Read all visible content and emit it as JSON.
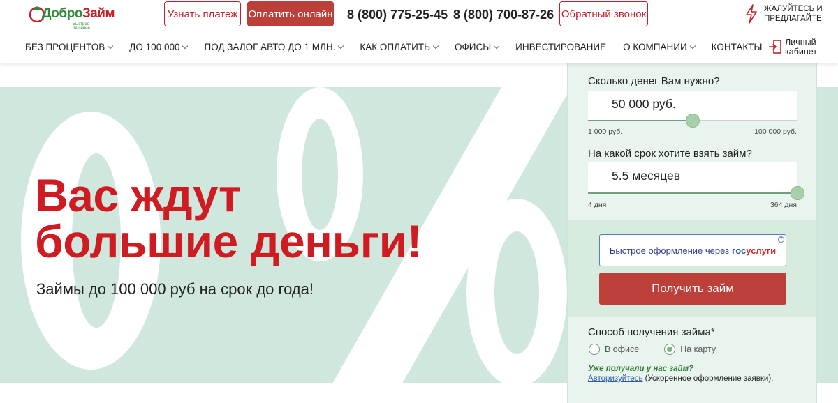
{
  "header": {
    "logo_text_1": "Добро",
    "logo_text_2": "Займ",
    "logo_sub": "Быстрое решение",
    "check_payment": "Узнать платеж",
    "pay_online": "Оплатить онлайн",
    "phone_1": "8 (800) 775-25-45",
    "phone_2": "8 (800) 700-87-26",
    "callback": "Обратный звонок",
    "complain_1": "ЖАЛУЙТЕСЬ И",
    "complain_2": "ПРЕДЛАГАЙТЕ",
    "cabinet_1": "Личный",
    "cabinet_2": "кабинет"
  },
  "nav": [
    {
      "label": "БЕЗ ПРОЦЕНТОВ",
      "dropdown": true
    },
    {
      "label": "ДО 100 000",
      "dropdown": true
    },
    {
      "label": "ПОД ЗАЛОГ АВТО ДО 1 МЛН.",
      "dropdown": true
    },
    {
      "label": "КАК ОПЛАТИТЬ",
      "dropdown": true
    },
    {
      "label": "ОФИСЫ",
      "dropdown": true
    },
    {
      "label": "ИНВЕСТИРОВАНИЕ",
      "dropdown": false
    },
    {
      "label": "О КОМПАНИИ",
      "dropdown": true
    },
    {
      "label": "КОНТАКТЫ",
      "dropdown": false
    }
  ],
  "hero": {
    "line_1": "Вас ждут",
    "line_2": "большие деньги!",
    "subtitle": "Займы до 100 000 руб на срок до года!"
  },
  "calculator": {
    "amount_label": "Сколько денег Вам нужно?",
    "amount_value": "50 000 руб.",
    "amount_min": "1 000 руб.",
    "amount_max": "100 000 руб.",
    "amount_fraction": 0.5,
    "term_label": "На какой срок хотите взять займ?",
    "term_value": "5.5 месяцев",
    "term_min": "4 дня",
    "term_max": "364 дня",
    "term_fraction": 1.0,
    "gosuslugi_prefix": "Быстрое оформление через",
    "gosuslugi_g1": "гос",
    "gosuslugi_g2": "услуги",
    "get_loan": "Получить займ",
    "method_label": "Способ получения займа*",
    "method_office": "В офисе",
    "method_card": "На карту",
    "already_label": "Уже получали у нас займ?",
    "auth_link": "Авторизуйтесь",
    "auth_rest": " (Ускоренное оформление заявки)."
  },
  "colors": {
    "brand_red": "#cf1b22",
    "brand_green": "#2e8b3a",
    "button_red": "#bd3f3a",
    "hero_band": "#cfe7dc",
    "panel": "#eaf4ee"
  }
}
